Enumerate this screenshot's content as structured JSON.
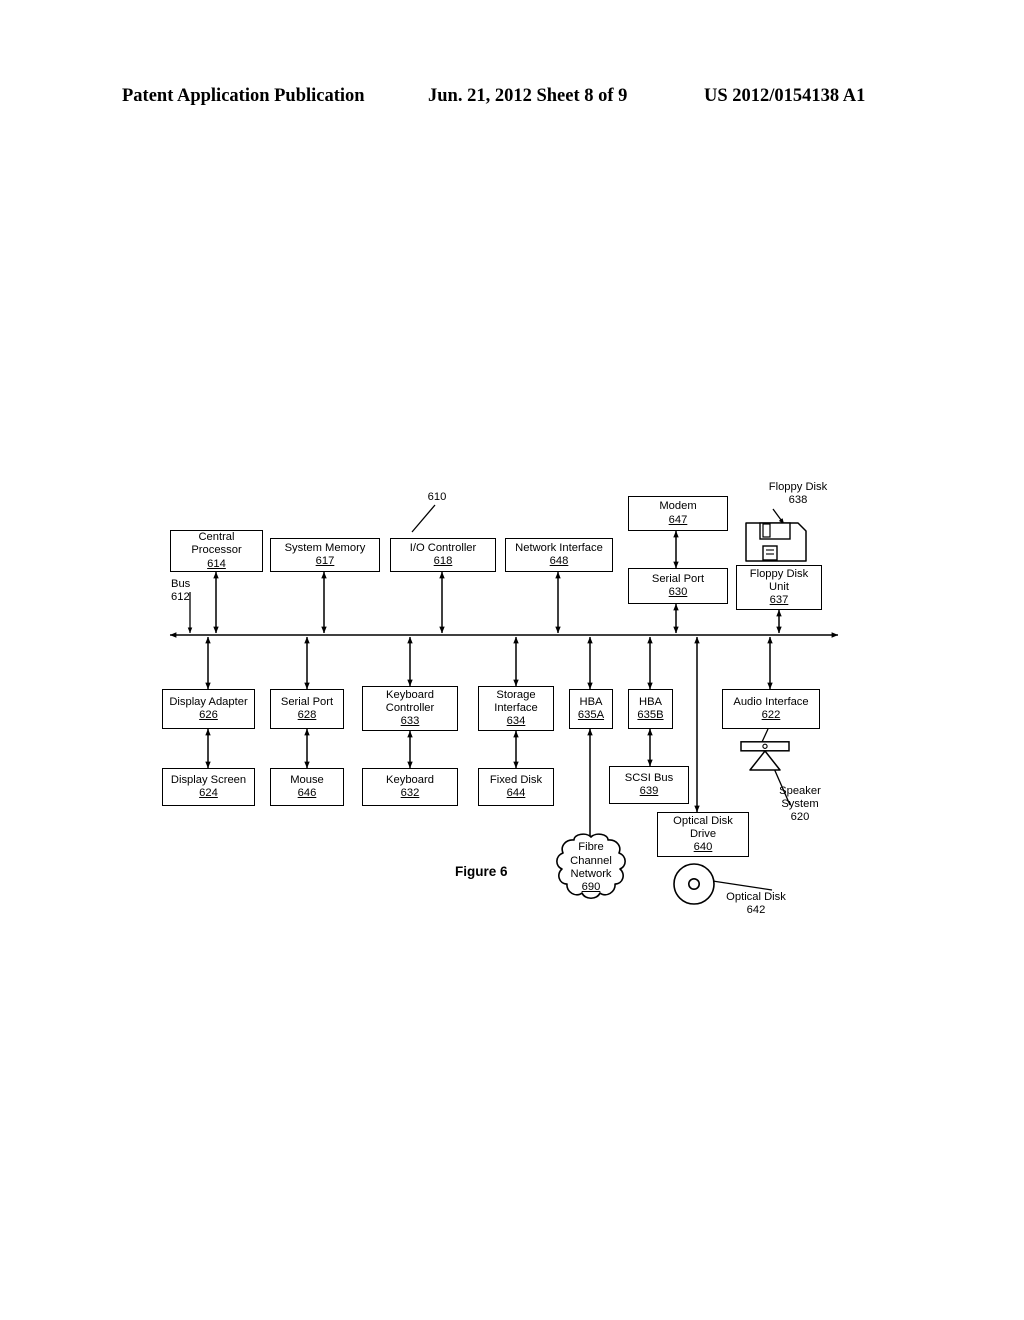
{
  "header": {
    "left": "Patent Application Publication",
    "middle": "Jun. 21, 2012  Sheet 8 of 9",
    "right": "US 2012/0154138 A1"
  },
  "figure": {
    "caption": "Figure 6",
    "system_ref": "610"
  },
  "bus": {
    "label": "Bus",
    "ref": "612"
  },
  "nodes": {
    "central_processor": {
      "title": "Central\nProcessor",
      "ref": "614"
    },
    "system_memory": {
      "title": "System Memory",
      "ref": "617"
    },
    "io_controller": {
      "title": "I/O Controller",
      "ref": "618"
    },
    "network_interface": {
      "title": "Network Interface",
      "ref": "648"
    },
    "modem": {
      "title": "Modem",
      "ref": "647"
    },
    "serial_port_top": {
      "title": "Serial Port",
      "ref": "630"
    },
    "floppy_disk_unit": {
      "title": "Floppy Disk\nUnit",
      "ref": "637"
    },
    "display_adapter": {
      "title": "Display Adapter",
      "ref": "626"
    },
    "serial_port_bottom": {
      "title": "Serial Port",
      "ref": "628"
    },
    "keyboard_controller": {
      "title": "Keyboard\nController",
      "ref": "633"
    },
    "storage_interface": {
      "title": "Storage\nInterface",
      "ref": "634"
    },
    "hba_a": {
      "title": "HBA",
      "ref": "635A"
    },
    "hba_b": {
      "title": "HBA",
      "ref": "635B"
    },
    "audio_interface": {
      "title": "Audio Interface",
      "ref": "622"
    },
    "display_screen": {
      "title": "Display Screen",
      "ref": "624"
    },
    "mouse": {
      "title": "Mouse",
      "ref": "646"
    },
    "keyboard": {
      "title": "Keyboard",
      "ref": "632"
    },
    "fixed_disk": {
      "title": "Fixed Disk",
      "ref": "644"
    },
    "scsi_bus": {
      "title": "SCSI Bus",
      "ref": "639"
    },
    "optical_disk_drive": {
      "title": "Optical Disk\nDrive",
      "ref": "640"
    }
  },
  "cloud": {
    "title": "Fibre\nChannel\nNetwork",
    "ref": "690"
  },
  "callouts": {
    "floppy_disk": {
      "title": "Floppy Disk",
      "ref": "638"
    },
    "speaker_system": {
      "title": "Speaker\nSystem",
      "ref": "620"
    },
    "optical_disk": {
      "title": "Optical Disk",
      "ref": "642"
    }
  },
  "colors": {
    "ink": "#000000",
    "paper": "#ffffff"
  }
}
